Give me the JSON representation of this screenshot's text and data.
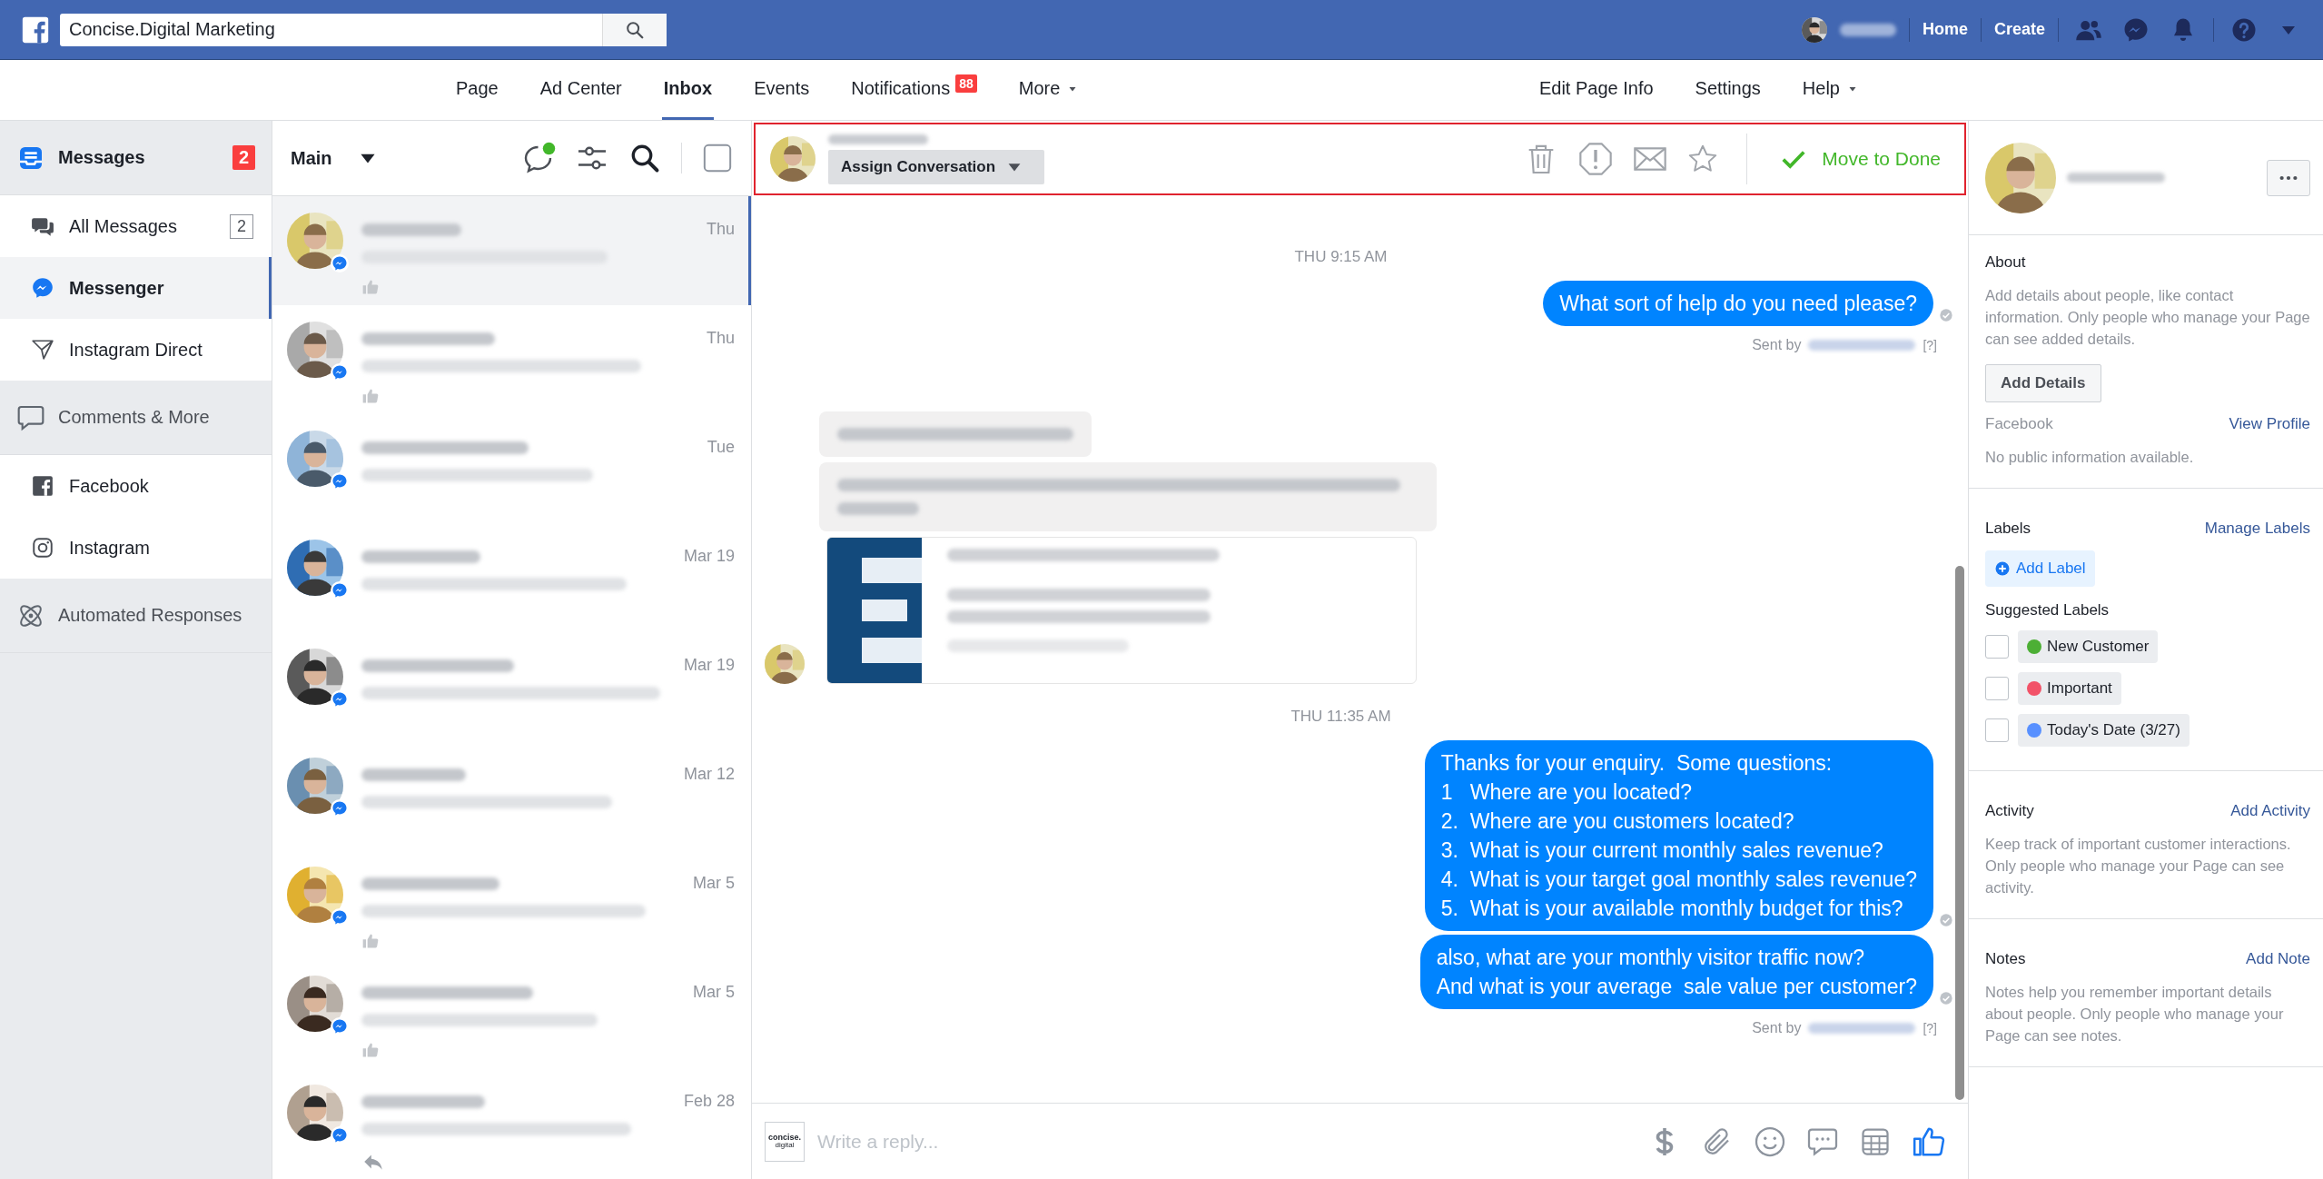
{
  "top_bar": {
    "search": {
      "value": "Concise.Digital Marketing"
    },
    "links": [
      "Home",
      "Create"
    ]
  },
  "page_nav": {
    "left": [
      {
        "label": "Page",
        "selected": false
      },
      {
        "label": "Ad Center",
        "selected": false
      },
      {
        "label": "Inbox",
        "selected": true
      },
      {
        "label": "Events",
        "selected": false
      },
      {
        "label": "Notifications",
        "badge": "88",
        "selected": false
      },
      {
        "label": "More",
        "dropdown": true,
        "selected": false
      }
    ],
    "right": [
      {
        "label": "Edit Page Info"
      },
      {
        "label": "Settings"
      },
      {
        "label": "Help",
        "dropdown": true
      }
    ]
  },
  "sidebar": [
    {
      "kind": "header",
      "label": "Messages",
      "badge": "2",
      "active": true
    },
    {
      "kind": "item",
      "label": "All Messages",
      "count": "2",
      "selected": false
    },
    {
      "kind": "item",
      "label": "Messenger",
      "selected": true
    },
    {
      "kind": "item",
      "label": "Instagram Direct",
      "selected": false
    },
    {
      "kind": "header",
      "label": "Comments & More",
      "active": false
    },
    {
      "kind": "item",
      "label": "Facebook",
      "selected": false
    },
    {
      "kind": "item",
      "label": "Instagram",
      "selected": false
    },
    {
      "kind": "header",
      "label": "Automated Responses",
      "active": false
    }
  ],
  "conversation_list": {
    "folder": "Main",
    "select_all": {
      "checked": false
    },
    "conversations": [
      {
        "date": "Thu",
        "selected": true,
        "kind": "reaction"
      },
      {
        "date": "Thu",
        "selected": false,
        "kind": "reaction"
      },
      {
        "date": "Tue",
        "selected": false,
        "kind": "plain"
      },
      {
        "date": "Mar 19",
        "selected": false,
        "kind": "plain"
      },
      {
        "date": "Mar 19",
        "selected": false,
        "kind": "plain"
      },
      {
        "date": "Mar 12",
        "selected": false,
        "kind": "plain"
      },
      {
        "date": "Mar 5",
        "selected": false,
        "kind": "reaction"
      },
      {
        "date": "Mar 5",
        "selected": false,
        "kind": "reaction"
      },
      {
        "date": "Feb 28",
        "selected": false,
        "kind": "reply"
      }
    ]
  },
  "chat": {
    "header": {
      "assign_button": "Assign Conversation",
      "done_button": "Move to Done",
      "outlined": true
    },
    "items": [
      {
        "kind": "timestamp",
        "text": "THU 9:15 AM"
      },
      {
        "kind": "outgoing",
        "lines": [
          "What sort of help do you need please?"
        ],
        "seen": true
      },
      {
        "kind": "sent_by",
        "text": "Sent by",
        "help": "[?]"
      },
      {
        "kind": "incoming_blurred"
      },
      {
        "kind": "timestamp",
        "text": "THU 11:35 AM"
      },
      {
        "kind": "outgoing",
        "lines": [
          "Thanks for your enquiry.  Some questions:",
          "1   Where are you located?",
          "2.  Where are you customers located?",
          "3.  What is your current monthly sales revenue?",
          "4.  What is your target goal monthly sales revenue?",
          "5.  What is your available monthly budget for this?"
        ],
        "seen": true
      },
      {
        "kind": "outgoing",
        "lines": [
          "also, what are your monthly visitor traffic now?",
          "And what is your average  sale value per customer?"
        ],
        "seen": true
      },
      {
        "kind": "sent_by",
        "text": "Sent by",
        "help": "[?]"
      }
    ],
    "composer": {
      "logo_lines": [
        "concise.",
        "digital"
      ],
      "placeholder": "Write a reply..."
    }
  },
  "contact_panel": {
    "about": {
      "title": "About",
      "text": "Add details about people, like contact information. Only people who manage your Page can see added details.",
      "button": "Add Details",
      "source": "Facebook",
      "source_link": "View Profile",
      "note": "No public information available."
    },
    "labels": {
      "title": "Labels",
      "link": "Manage Labels",
      "add_button": "Add Label",
      "suggested_title": "Suggested Labels",
      "suggested": [
        {
          "name": "New Customer",
          "color": "#4caf35",
          "checked": false
        },
        {
          "name": "Important",
          "color": "#f25268",
          "checked": false
        },
        {
          "name": "Today's Date (3/27)",
          "color": "#5890ff",
          "checked": false
        }
      ]
    },
    "activity": {
      "title": "Activity",
      "link": "Add Activity",
      "text": "Keep track of important customer interactions. Only people who manage your Page can see activity."
    },
    "notes": {
      "title": "Notes",
      "link": "Add Note",
      "text": "Notes help you remember important details about people. Only people who manage your Page can see notes."
    }
  }
}
